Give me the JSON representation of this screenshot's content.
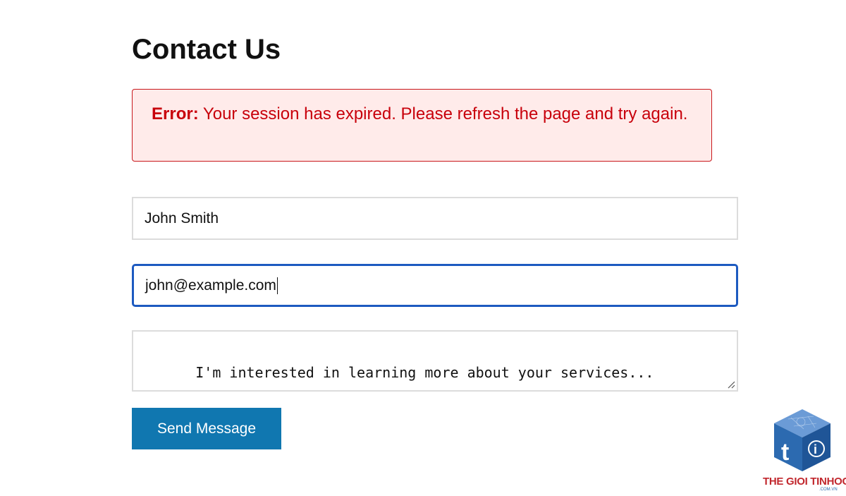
{
  "page": {
    "title": "Contact Us"
  },
  "error": {
    "label": "Error:",
    "message": " Your session has expired. Please refresh the page and try again."
  },
  "form": {
    "name_value": "John Smith",
    "email_value": "john@example.com",
    "message_value": "I'm interested in learning more about your services...",
    "submit_label": "Send Message"
  },
  "watermark": {
    "brand": "THE GIOI TINHOC",
    "sub": ".COM.VN"
  },
  "colors": {
    "error_text": "#c8000b",
    "error_bg": "#ffebea",
    "focus_border": "#1d5ac0",
    "button_bg": "#1077b0"
  }
}
